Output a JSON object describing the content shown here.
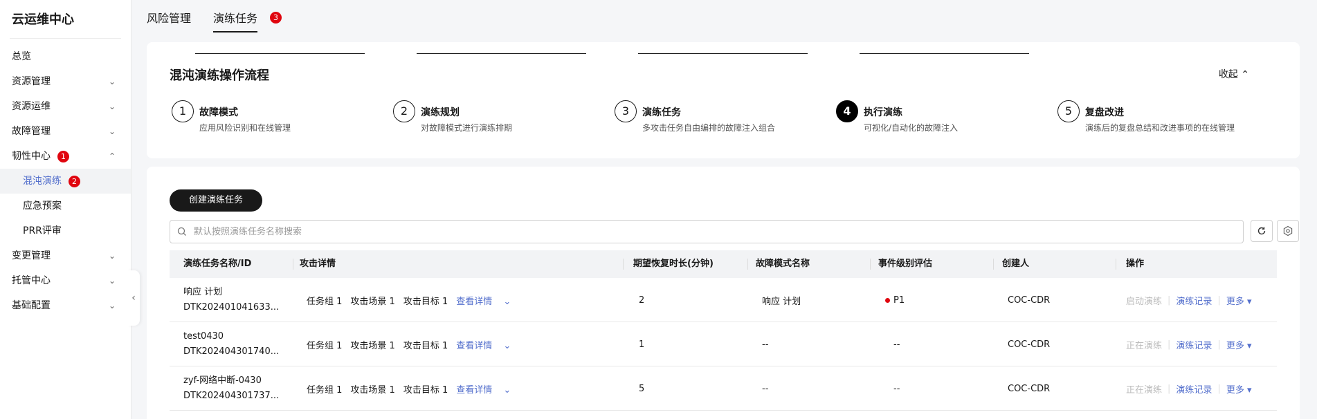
{
  "app": {
    "title": "云运维中心"
  },
  "sidebar": {
    "items": [
      {
        "label": "总览"
      },
      {
        "label": "资源管理"
      },
      {
        "label": "资源运维"
      },
      {
        "label": "故障管理"
      },
      {
        "label": "韧性中心",
        "badge": "1"
      },
      {
        "label": "混沌演练",
        "badge": "2"
      },
      {
        "label": "应急预案"
      },
      {
        "label": "PRR评审"
      },
      {
        "label": "变更管理"
      },
      {
        "label": "托管中心"
      },
      {
        "label": "基础配置"
      }
    ]
  },
  "tabs": [
    {
      "label": "风险管理"
    },
    {
      "label": "演练任务",
      "badge": "3"
    }
  ],
  "process": {
    "title": "混沌演练操作流程",
    "collapse_label": "收起",
    "steps": [
      {
        "num": "1",
        "title": "故障模式",
        "desc": "应用风险识别和在线管理"
      },
      {
        "num": "2",
        "title": "演练规划",
        "desc": "对故障模式进行演练排期"
      },
      {
        "num": "3",
        "title": "演练任务",
        "desc": "多攻击任务自由编排的故障注入组合"
      },
      {
        "num": "4",
        "title": "执行演练",
        "desc": "可视化/自动化的故障注入"
      },
      {
        "num": "5",
        "title": "复盘改进",
        "desc": "演练后的复盘总结和改进事项的在线管理"
      }
    ]
  },
  "tasks": {
    "create_label": "创建演练任务",
    "search_placeholder": "默认按照演练任务名称搜索",
    "columns": [
      "演练任务名称/ID",
      "攻击详情",
      "期望恢复时长(分钟)",
      "故障模式名称",
      "事件级别评估",
      "创建人",
      "操作"
    ],
    "rows": [
      {
        "name": "响应 计划",
        "id": "DTK202401041633...",
        "group": "任务组 1",
        "scene": "攻击场景 1",
        "target": "攻击目标 1",
        "detail": "查看详情",
        "duration": "2",
        "mode": "响应 计划",
        "level": "P1",
        "creator": "COC-CDR",
        "op1": "启动演练",
        "op2": "演练记录",
        "op3": "更多"
      },
      {
        "name": "test0430",
        "id": "DTK202404301740...",
        "group": "任务组 1",
        "scene": "攻击场景 1",
        "target": "攻击目标 1",
        "detail": "查看详情",
        "duration": "1",
        "mode": "--",
        "level": "--",
        "creator": "COC-CDR",
        "op1": "正在演练",
        "op2": "演练记录",
        "op3": "更多"
      },
      {
        "name": "zyf-网络中断-0430",
        "id": "DTK202404301737...",
        "group": "任务组 1",
        "scene": "攻击场景 1",
        "target": "攻击目标 1",
        "detail": "查看详情",
        "duration": "5",
        "mode": "--",
        "level": "--",
        "creator": "COC-CDR",
        "op1": "正在演练",
        "op2": "演练记录",
        "op3": "更多"
      }
    ]
  },
  "colors": {
    "accent": "#526ecc",
    "badge": "#e0050f",
    "dark": "#191919"
  }
}
